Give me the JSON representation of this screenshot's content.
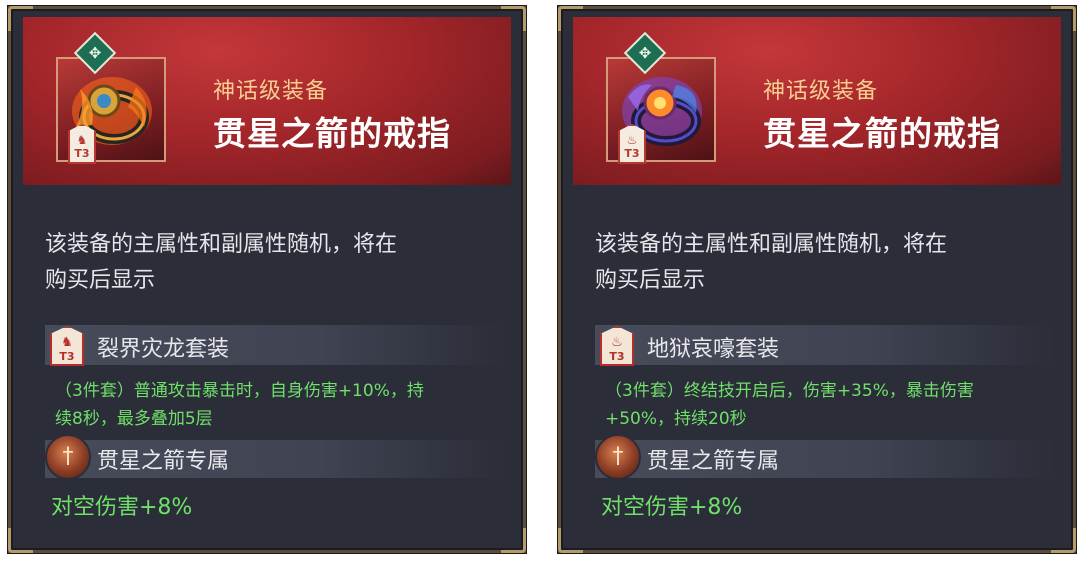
{
  "cards": [
    {
      "rarity": "神话级装备",
      "title": "贯星之箭的戒指",
      "rarity_badge_icon": "jade-diamond-icon",
      "tier_label": "T3",
      "description_line1": "该装备的主属性和副属性随机，将在",
      "description_line2": "购买后显示",
      "set_name": "裂界灾龙套装",
      "set_tier": "T3",
      "set_effect_line1": "（3件套）普通攻击暴击时，自身伤害+10%，持",
      "set_effect_line2": "续8秒，最多叠加5层",
      "exclusive_name": "贯星之箭专属",
      "exclusive_effect": "对空伤害+8%",
      "ring_color": "#e8a640"
    },
    {
      "rarity": "神话级装备",
      "title": "贯星之箭的戒指",
      "rarity_badge_icon": "jade-diamond-icon",
      "tier_label": "T3",
      "description_line1": "该装备的主属性和副属性随机，将在",
      "description_line2": "购买后显示",
      "set_name": "地狱哀嚎套装",
      "set_tier": "T3",
      "set_effect_line1": "（3件套）终结技开启后，伤害+35%，暴击伤害",
      "set_effect_line2": "+50%，持续20秒",
      "exclusive_name": "贯星之箭专属",
      "exclusive_effect": "对空伤害+8%",
      "ring_color": "#5a49c8"
    }
  ],
  "colors": {
    "rarity_text": "#f6cf90",
    "effect_green": "#6fe06a",
    "header_red": "#a3262a",
    "panel_bg": "#2b2d38"
  }
}
